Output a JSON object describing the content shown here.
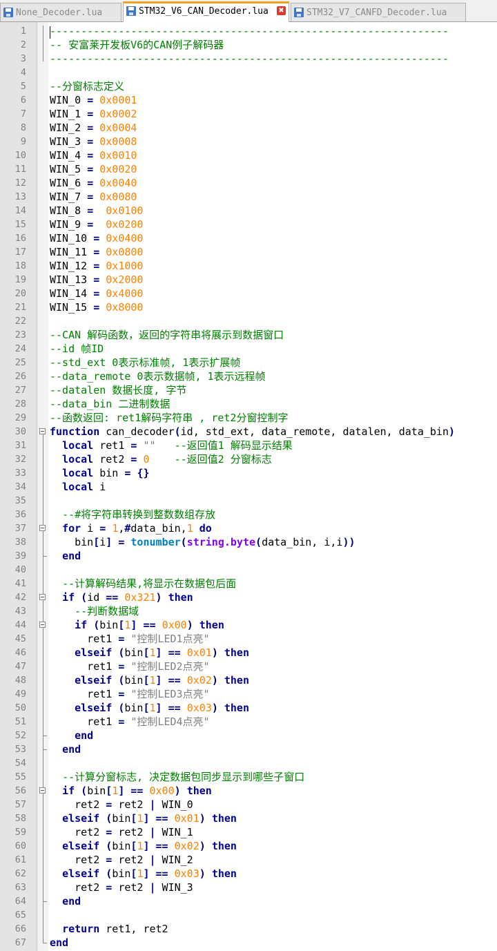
{
  "tabs": [
    {
      "label": "None_Decoder.lua",
      "active": false,
      "icon": "save-icon"
    },
    {
      "label": "STM32_V6_CAN_Decoder.lua",
      "active": true,
      "icon": "save-icon"
    },
    {
      "label": "STM32_V7_CANFD_Decoder.lua",
      "active": false,
      "icon": "save-icon"
    }
  ],
  "close_symbol": "✖",
  "colors": {
    "comment": "#008000",
    "number": "#ff8000",
    "keyword": "#00008b",
    "string": "#808080",
    "builtin_function": "#0080c0",
    "library": "#8000ff",
    "active_tab_accent": "#f5a01a"
  },
  "lines": [
    [
      [
        "c",
        "----------------------------------------------------------------"
      ]
    ],
    [
      [
        "c",
        "-- 安富莱开发板V6的CAN例子解码器"
      ]
    ],
    [
      [
        "c",
        "----------------------------------------------------------------"
      ]
    ],
    [],
    [
      [
        "c",
        "--分窗标志定义"
      ]
    ],
    [
      [
        "x",
        "WIN_0 "
      ],
      [
        "p",
        "="
      ],
      [
        "x",
        " "
      ],
      [
        "n",
        "0x0001"
      ]
    ],
    [
      [
        "x",
        "WIN_1 "
      ],
      [
        "p",
        "="
      ],
      [
        "x",
        " "
      ],
      [
        "n",
        "0x0002"
      ]
    ],
    [
      [
        "x",
        "WIN_2 "
      ],
      [
        "p",
        "="
      ],
      [
        "x",
        " "
      ],
      [
        "n",
        "0x0004"
      ]
    ],
    [
      [
        "x",
        "WIN_3 "
      ],
      [
        "p",
        "="
      ],
      [
        "x",
        " "
      ],
      [
        "n",
        "0x0008"
      ]
    ],
    [
      [
        "x",
        "WIN_4 "
      ],
      [
        "p",
        "="
      ],
      [
        "x",
        " "
      ],
      [
        "n",
        "0x0010"
      ]
    ],
    [
      [
        "x",
        "WIN_5 "
      ],
      [
        "p",
        "="
      ],
      [
        "x",
        " "
      ],
      [
        "n",
        "0x0020"
      ]
    ],
    [
      [
        "x",
        "WIN_6 "
      ],
      [
        "p",
        "="
      ],
      [
        "x",
        " "
      ],
      [
        "n",
        "0x0040"
      ]
    ],
    [
      [
        "x",
        "WIN_7 "
      ],
      [
        "p",
        "="
      ],
      [
        "x",
        " "
      ],
      [
        "n",
        "0x0080"
      ]
    ],
    [
      [
        "x",
        "WIN_8 "
      ],
      [
        "p",
        "="
      ],
      [
        "x",
        "  "
      ],
      [
        "n",
        "0x0100"
      ]
    ],
    [
      [
        "x",
        "WIN_9 "
      ],
      [
        "p",
        "="
      ],
      [
        "x",
        "  "
      ],
      [
        "n",
        "0x0200"
      ]
    ],
    [
      [
        "x",
        "WIN_10 "
      ],
      [
        "p",
        "="
      ],
      [
        "x",
        " "
      ],
      [
        "n",
        "0x0400"
      ]
    ],
    [
      [
        "x",
        "WIN_11 "
      ],
      [
        "p",
        "="
      ],
      [
        "x",
        " "
      ],
      [
        "n",
        "0x0800"
      ]
    ],
    [
      [
        "x",
        "WIN_12 "
      ],
      [
        "p",
        "="
      ],
      [
        "x",
        " "
      ],
      [
        "n",
        "0x1000"
      ]
    ],
    [
      [
        "x",
        "WIN_13 "
      ],
      [
        "p",
        "="
      ],
      [
        "x",
        " "
      ],
      [
        "n",
        "0x2000"
      ]
    ],
    [
      [
        "x",
        "WIN_14 "
      ],
      [
        "p",
        "="
      ],
      [
        "x",
        " "
      ],
      [
        "n",
        "0x4000"
      ]
    ],
    [
      [
        "x",
        "WIN_15 "
      ],
      [
        "p",
        "="
      ],
      [
        "x",
        " "
      ],
      [
        "n",
        "0x8000"
      ]
    ],
    [],
    [
      [
        "c",
        "--CAN 解码函数，返回的字符串将展示到数据窗口"
      ]
    ],
    [
      [
        "c",
        "--id 帧ID"
      ]
    ],
    [
      [
        "c",
        "--std_ext 0表示标准帧, 1表示扩展帧"
      ]
    ],
    [
      [
        "c",
        "--data_remote 0表示数据帧, 1表示远程帧"
      ]
    ],
    [
      [
        "c",
        "--datalen 数据长度, 字节"
      ]
    ],
    [
      [
        "c",
        "--data_bin 二进制数据"
      ]
    ],
    [
      [
        "c",
        "--函数返回: ret1解码字符串 , ret2分窗控制字"
      ]
    ],
    [
      [
        "k",
        "function"
      ],
      [
        "x",
        " can_decoder"
      ],
      [
        "p",
        "("
      ],
      [
        "x",
        "id, std_ext, data_remote, datalen, data_bin"
      ],
      [
        "p",
        ")"
      ]
    ],
    [
      [
        "x",
        "  "
      ],
      [
        "k",
        "local"
      ],
      [
        "x",
        " ret1 "
      ],
      [
        "p",
        "="
      ],
      [
        "x",
        " "
      ],
      [
        "s",
        "\"\""
      ],
      [
        "x",
        "   "
      ],
      [
        "c",
        "--返回值1 解码显示结果"
      ]
    ],
    [
      [
        "x",
        "  "
      ],
      [
        "k",
        "local"
      ],
      [
        "x",
        " ret2 "
      ],
      [
        "p",
        "="
      ],
      [
        "x",
        " "
      ],
      [
        "n",
        "0"
      ],
      [
        "x",
        "    "
      ],
      [
        "c",
        "--返回值2 分窗标志"
      ]
    ],
    [
      [
        "x",
        "  "
      ],
      [
        "k",
        "local"
      ],
      [
        "x",
        " bin "
      ],
      [
        "p",
        "="
      ],
      [
        "x",
        " "
      ],
      [
        "p",
        "{}"
      ]
    ],
    [
      [
        "x",
        "  "
      ],
      [
        "k",
        "local"
      ],
      [
        "x",
        " i"
      ]
    ],
    [],
    [
      [
        "x",
        "  "
      ],
      [
        "c",
        "--#将字符串转换到整数数组存放"
      ]
    ],
    [
      [
        "x",
        "  "
      ],
      [
        "k",
        "for"
      ],
      [
        "x",
        " i "
      ],
      [
        "p",
        "="
      ],
      [
        "x",
        " "
      ],
      [
        "n",
        "1"
      ],
      [
        "x",
        ","
      ],
      [
        "p",
        "#"
      ],
      [
        "x",
        "data_bin,"
      ],
      [
        "n",
        "1"
      ],
      [
        "x",
        " "
      ],
      [
        "k",
        "do"
      ]
    ],
    [
      [
        "x",
        "    bin"
      ],
      [
        "p",
        "["
      ],
      [
        "x",
        "i"
      ],
      [
        "p",
        "]"
      ],
      [
        "x",
        " "
      ],
      [
        "p",
        "="
      ],
      [
        "x",
        " "
      ],
      [
        "f",
        "tonumber"
      ],
      [
        "p",
        "("
      ],
      [
        "m",
        "string.byte"
      ],
      [
        "p",
        "("
      ],
      [
        "x",
        "data_bin, i,i"
      ],
      [
        "p",
        "))"
      ]
    ],
    [
      [
        "x",
        "  "
      ],
      [
        "k",
        "end"
      ]
    ],
    [],
    [
      [
        "x",
        "  "
      ],
      [
        "c",
        "--计算解码结果,将显示在数据包后面"
      ]
    ],
    [
      [
        "x",
        "  "
      ],
      [
        "k",
        "if"
      ],
      [
        "x",
        " "
      ],
      [
        "p",
        "("
      ],
      [
        "x",
        "id "
      ],
      [
        "p",
        "=="
      ],
      [
        "x",
        " "
      ],
      [
        "n",
        "0x321"
      ],
      [
        "p",
        ")"
      ],
      [
        "x",
        " "
      ],
      [
        "k",
        "then"
      ]
    ],
    [
      [
        "x",
        "    "
      ],
      [
        "c",
        "--判断数据域"
      ]
    ],
    [
      [
        "x",
        "    "
      ],
      [
        "k",
        "if"
      ],
      [
        "x",
        " "
      ],
      [
        "p",
        "("
      ],
      [
        "x",
        "bin"
      ],
      [
        "p",
        "["
      ],
      [
        "n",
        "1"
      ],
      [
        "p",
        "]"
      ],
      [
        "x",
        " "
      ],
      [
        "p",
        "=="
      ],
      [
        "x",
        " "
      ],
      [
        "n",
        "0x00"
      ],
      [
        "p",
        ")"
      ],
      [
        "x",
        " "
      ],
      [
        "k",
        "then"
      ]
    ],
    [
      [
        "x",
        "      ret1 "
      ],
      [
        "p",
        "="
      ],
      [
        "x",
        " "
      ],
      [
        "s",
        "\"控制LED1点亮\""
      ]
    ],
    [
      [
        "x",
        "    "
      ],
      [
        "k",
        "elseif"
      ],
      [
        "x",
        " "
      ],
      [
        "p",
        "("
      ],
      [
        "x",
        "bin"
      ],
      [
        "p",
        "["
      ],
      [
        "n",
        "1"
      ],
      [
        "p",
        "]"
      ],
      [
        "x",
        " "
      ],
      [
        "p",
        "=="
      ],
      [
        "x",
        " "
      ],
      [
        "n",
        "0x01"
      ],
      [
        "p",
        ")"
      ],
      [
        "x",
        " "
      ],
      [
        "k",
        "then"
      ]
    ],
    [
      [
        "x",
        "      ret1 "
      ],
      [
        "p",
        "="
      ],
      [
        "x",
        " "
      ],
      [
        "s",
        "\"控制LED2点亮\""
      ]
    ],
    [
      [
        "x",
        "    "
      ],
      [
        "k",
        "elseif"
      ],
      [
        "x",
        " "
      ],
      [
        "p",
        "("
      ],
      [
        "x",
        "bin"
      ],
      [
        "p",
        "["
      ],
      [
        "n",
        "1"
      ],
      [
        "p",
        "]"
      ],
      [
        "x",
        " "
      ],
      [
        "p",
        "=="
      ],
      [
        "x",
        " "
      ],
      [
        "n",
        "0x02"
      ],
      [
        "p",
        ")"
      ],
      [
        "x",
        " "
      ],
      [
        "k",
        "then"
      ]
    ],
    [
      [
        "x",
        "      ret1 "
      ],
      [
        "p",
        "="
      ],
      [
        "x",
        " "
      ],
      [
        "s",
        "\"控制LED3点亮\""
      ]
    ],
    [
      [
        "x",
        "    "
      ],
      [
        "k",
        "elseif"
      ],
      [
        "x",
        " "
      ],
      [
        "p",
        "("
      ],
      [
        "x",
        "bin"
      ],
      [
        "p",
        "["
      ],
      [
        "n",
        "1"
      ],
      [
        "p",
        "]"
      ],
      [
        "x",
        " "
      ],
      [
        "p",
        "=="
      ],
      [
        "x",
        " "
      ],
      [
        "n",
        "0x03"
      ],
      [
        "p",
        ")"
      ],
      [
        "x",
        " "
      ],
      [
        "k",
        "then"
      ]
    ],
    [
      [
        "x",
        "      ret1 "
      ],
      [
        "p",
        "="
      ],
      [
        "x",
        " "
      ],
      [
        "s",
        "\"控制LED4点亮\""
      ]
    ],
    [
      [
        "x",
        "    "
      ],
      [
        "k",
        "end"
      ]
    ],
    [
      [
        "x",
        "  "
      ],
      [
        "k",
        "end"
      ]
    ],
    [],
    [
      [
        "x",
        "  "
      ],
      [
        "c",
        "--计算分窗标志, 决定数据包同步显示到哪些子窗口"
      ]
    ],
    [
      [
        "x",
        "  "
      ],
      [
        "k",
        "if"
      ],
      [
        "x",
        " "
      ],
      [
        "p",
        "("
      ],
      [
        "x",
        "bin"
      ],
      [
        "p",
        "["
      ],
      [
        "n",
        "1"
      ],
      [
        "p",
        "]"
      ],
      [
        "x",
        " "
      ],
      [
        "p",
        "=="
      ],
      [
        "x",
        " "
      ],
      [
        "n",
        "0x00"
      ],
      [
        "p",
        ")"
      ],
      [
        "x",
        " "
      ],
      [
        "k",
        "then"
      ]
    ],
    [
      [
        "x",
        "    ret2 "
      ],
      [
        "p",
        "="
      ],
      [
        "x",
        " ret2 "
      ],
      [
        "p",
        "|"
      ],
      [
        "x",
        " WIN_0"
      ]
    ],
    [
      [
        "x",
        "  "
      ],
      [
        "k",
        "elseif"
      ],
      [
        "x",
        " "
      ],
      [
        "p",
        "("
      ],
      [
        "x",
        "bin"
      ],
      [
        "p",
        "["
      ],
      [
        "n",
        "1"
      ],
      [
        "p",
        "]"
      ],
      [
        "x",
        " "
      ],
      [
        "p",
        "=="
      ],
      [
        "x",
        " "
      ],
      [
        "n",
        "0x01"
      ],
      [
        "p",
        ")"
      ],
      [
        "x",
        " "
      ],
      [
        "k",
        "then"
      ]
    ],
    [
      [
        "x",
        "    ret2 "
      ],
      [
        "p",
        "="
      ],
      [
        "x",
        " ret2 "
      ],
      [
        "p",
        "|"
      ],
      [
        "x",
        " WIN_1"
      ]
    ],
    [
      [
        "x",
        "  "
      ],
      [
        "k",
        "elseif"
      ],
      [
        "x",
        " "
      ],
      [
        "p",
        "("
      ],
      [
        "x",
        "bin"
      ],
      [
        "p",
        "["
      ],
      [
        "n",
        "1"
      ],
      [
        "p",
        "]"
      ],
      [
        "x",
        " "
      ],
      [
        "p",
        "=="
      ],
      [
        "x",
        " "
      ],
      [
        "n",
        "0x02"
      ],
      [
        "p",
        ")"
      ],
      [
        "x",
        " "
      ],
      [
        "k",
        "then"
      ]
    ],
    [
      [
        "x",
        "    ret2 "
      ],
      [
        "p",
        "="
      ],
      [
        "x",
        " ret2 "
      ],
      [
        "p",
        "|"
      ],
      [
        "x",
        " WIN_2"
      ]
    ],
    [
      [
        "x",
        "  "
      ],
      [
        "k",
        "elseif"
      ],
      [
        "x",
        " "
      ],
      [
        "p",
        "("
      ],
      [
        "x",
        "bin"
      ],
      [
        "p",
        "["
      ],
      [
        "n",
        "1"
      ],
      [
        "p",
        "]"
      ],
      [
        "x",
        " "
      ],
      [
        "p",
        "=="
      ],
      [
        "x",
        " "
      ],
      [
        "n",
        "0x03"
      ],
      [
        "p",
        ")"
      ],
      [
        "x",
        " "
      ],
      [
        "k",
        "then"
      ]
    ],
    [
      [
        "x",
        "    ret2 "
      ],
      [
        "p",
        "="
      ],
      [
        "x",
        " ret2 "
      ],
      [
        "p",
        "|"
      ],
      [
        "x",
        " WIN_3"
      ]
    ],
    [
      [
        "x",
        "  "
      ],
      [
        "k",
        "end"
      ]
    ],
    [],
    [
      [
        "x",
        "  "
      ],
      [
        "k",
        "return"
      ],
      [
        "x",
        " ret1, ret2"
      ]
    ],
    [
      [
        "k",
        "end"
      ]
    ]
  ]
}
